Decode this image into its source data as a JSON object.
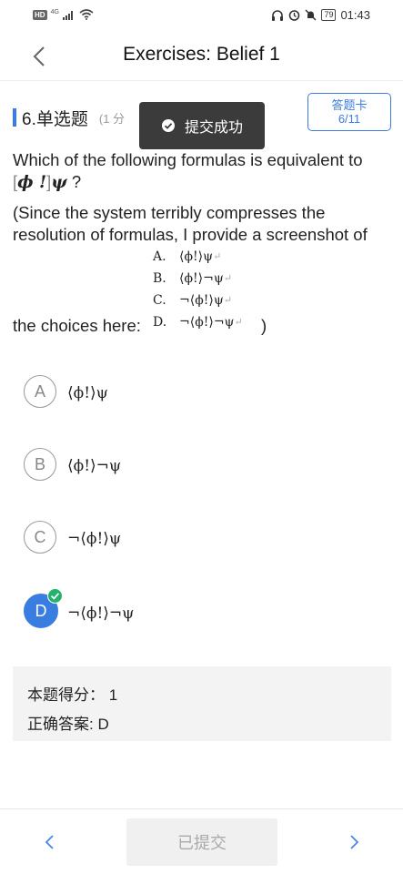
{
  "status_bar": {
    "hd": "HD",
    "network": "4G",
    "battery": "79",
    "time": "01:43",
    "icons": [
      "headphones-icon",
      "alarm-icon",
      "mute-icon",
      "battery-icon"
    ]
  },
  "nav": {
    "title": "Exercises: Belief 1",
    "back_icon": "chevron-left-icon"
  },
  "question": {
    "number_type": "6.单选题",
    "points": "(1 分",
    "text": "Which of the following formulas is equivalent to",
    "formula_tail": "?",
    "note": "(Since the system terribly compresses the resolution of formulas, I provide a screenshot of",
    "choices_prefix": "the choices here:",
    "choices_suffix": ")",
    "screenshot_choices": [
      {
        "letter": "A.",
        "formula": "⟨ϕ!⟩ψ"
      },
      {
        "letter": "B.",
        "formula": "⟨ϕ!⟩¬ψ"
      },
      {
        "letter": "C.",
        "formula": "¬⟨ϕ!⟩ψ"
      },
      {
        "letter": "D.",
        "formula": "¬⟨ϕ!⟩¬ψ"
      }
    ]
  },
  "answer_card": {
    "label": "答题卡",
    "progress": "6/11"
  },
  "toast": {
    "text": "提交成功",
    "icon": "check-circle-icon"
  },
  "options": [
    {
      "letter": "A",
      "formula": "⟨ϕ!⟩ψ",
      "selected": false
    },
    {
      "letter": "B",
      "formula": "⟨ϕ!⟩¬ψ",
      "selected": false
    },
    {
      "letter": "C",
      "formula": "¬⟨ϕ!⟩ψ",
      "selected": false
    },
    {
      "letter": "D",
      "formula": "¬⟨ϕ!⟩¬ψ",
      "selected": true
    }
  ],
  "score": {
    "score_label": "本题得分：",
    "score_value": "1",
    "answer_label": "正确答案:",
    "answer_value": "D"
  },
  "bottom": {
    "submitted_label": "已提交",
    "prev_icon": "chevron-left-icon",
    "next_icon": "chevron-right-icon"
  },
  "colors": {
    "accent": "#3c7be0",
    "selected": "#3a7de0",
    "check": "#22b26b",
    "toast_bg": "#3b3b3b"
  }
}
